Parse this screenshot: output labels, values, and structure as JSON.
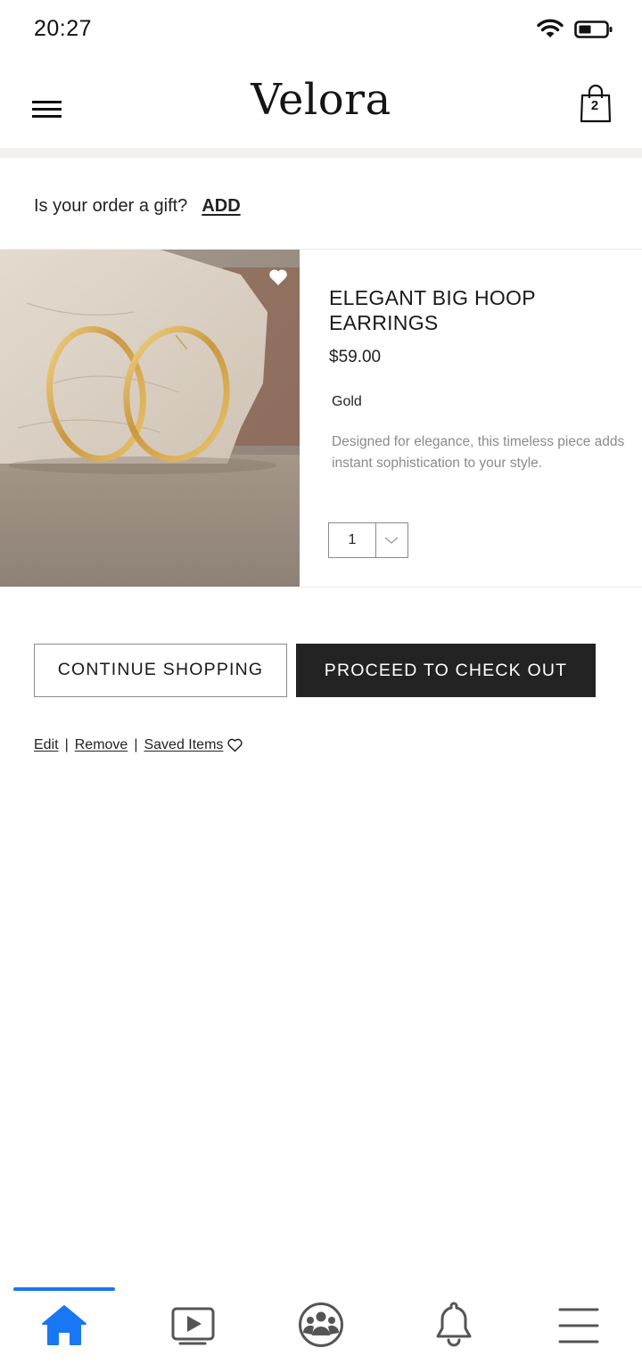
{
  "status_bar": {
    "time": "20:27",
    "icons": [
      "wifi-icon",
      "battery-icon"
    ]
  },
  "header": {
    "brand": "Velora",
    "cart_count": "2",
    "icons": [
      "menu-icon",
      "shopping-bag-icon"
    ]
  },
  "gift": {
    "prompt": "Is your order a gift?",
    "action": "ADD"
  },
  "product": {
    "title": "ELEGANT BIG HOOP EARRINGS",
    "price": "$59.00",
    "variant": "Gold",
    "description": "Designed for elegance, this timeless piece adds instant sophistication to your style.",
    "quantity": "1",
    "favorite_icon": "heart-icon"
  },
  "actions": {
    "continue_label": "CONTINUE SHOPPING",
    "checkout_label": "PROCEED TO CHECK OUT"
  },
  "item_links": {
    "edit": "Edit",
    "remove": "Remove",
    "saved": "Saved Items",
    "separator": "|"
  },
  "bottom_nav": {
    "items": [
      "home-icon",
      "video-icon",
      "groups-icon",
      "bell-icon",
      "menu-icon"
    ],
    "active": "home-icon",
    "active_color": "#1877f2"
  },
  "colors": {
    "checkout_bg": "#232323",
    "muted_text": "#8b8b8b"
  }
}
